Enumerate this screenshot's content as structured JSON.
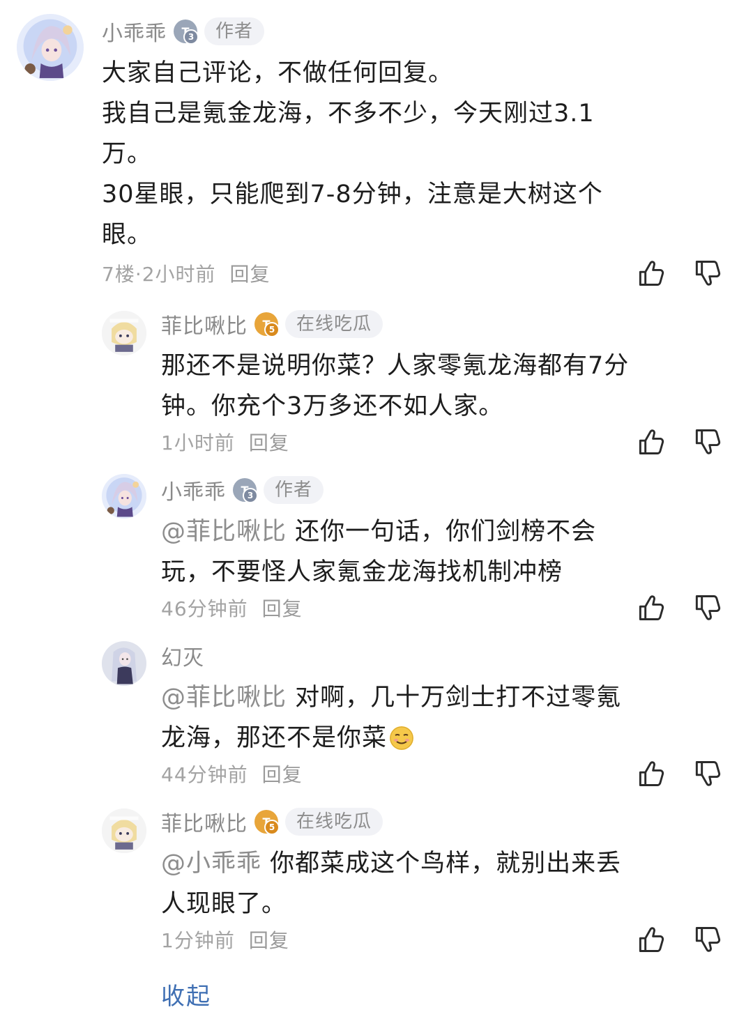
{
  "comments": [
    {
      "username": "小乖乖",
      "level_badge": "T3",
      "tag": "作者",
      "paragraphs": [
        "大家自己评论，不做任何回复。",
        "我自己是氪金龙海，不多不少，今天刚过3.1",
        "万。",
        "30星眼，只能爬到7-8分钟，注意是大树这个",
        "眼。"
      ],
      "meta": "7楼·2小时前",
      "reply_label": "回复"
    }
  ],
  "replies": [
    {
      "username": "菲比啾比",
      "level_badge": "T5",
      "tag": "在线吃瓜",
      "mention": "",
      "lines": [
        "那还不是说明你菜？人家零氪龙海都有7分",
        "钟。你充个3万多还不如人家。"
      ],
      "time": "1小时前",
      "reply_label": "回复"
    },
    {
      "username": "小乖乖",
      "level_badge": "T3",
      "tag": "作者",
      "mention": "@菲比啾比",
      "lines": [
        " 还你一句话，你们剑榜不会",
        "玩，不要怪人家氪金龙海找机制冲榜"
      ],
      "time": "46分钟前",
      "reply_label": "回复"
    },
    {
      "username": "幻灭",
      "level_badge": "",
      "tag": "",
      "mention": "@菲比啾比",
      "lines": [
        " 对啊，几十万剑士打不过零氪",
        "龙海，那还不是你菜"
      ],
      "time": "44分钟前",
      "reply_label": "回复"
    },
    {
      "username": "菲比啾比",
      "level_badge": "T5",
      "tag": "在线吃瓜",
      "mention": "@小乖乖",
      "lines": [
        " 你都菜成这个鸟样，就别出来丢",
        "人现眼了。"
      ],
      "time": "1分钟前",
      "reply_label": "回复"
    }
  ],
  "collapse_label": "收起",
  "icons": {
    "like": "thumbs-up-icon",
    "dislike": "thumbs-down-icon",
    "emoji": "smirk-emoji-icon"
  },
  "colors": {
    "username": "#8a8a8a",
    "meta": "#a3a3a3",
    "link": "#3f6fb3",
    "tag_bg": "#f1f2f6"
  }
}
